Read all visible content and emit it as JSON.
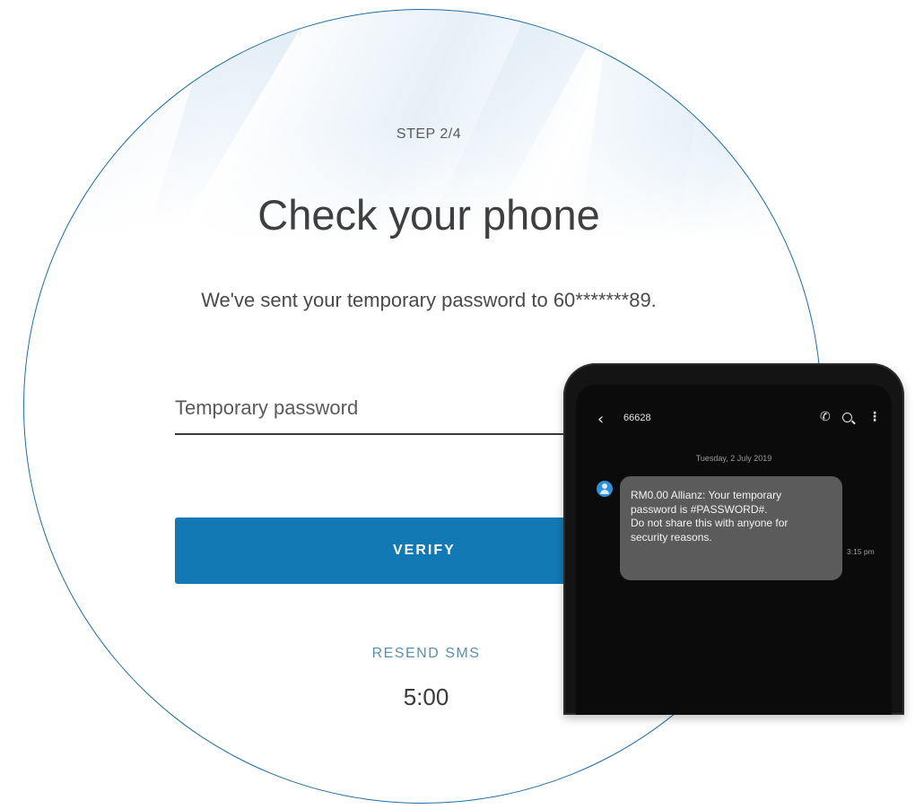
{
  "step_label": "STEP 2/4",
  "title": "Check your phone",
  "subtitle": "We've sent your temporary password to 60*******89.",
  "password_field": {
    "placeholder": "Temporary password",
    "value": ""
  },
  "verify_button": "VERIFY",
  "resend_label": "RESEND SMS",
  "timer": "5:00",
  "phone": {
    "sender": "66628",
    "date": "Tuesday, 2 July 2019",
    "message_lines": [
      "RM0.00 Allianz: Your temporary",
      "password is #PASSWORD#.",
      "Do not share this with anyone for",
      "security reasons."
    ],
    "time": "3:15 pm",
    "icons": {
      "back": "chevron-left-icon",
      "call": "phone-icon",
      "search": "search-icon",
      "menu": "more-vertical-icon",
      "contact": "avatar-icon"
    }
  },
  "colors": {
    "accent": "#1379b5",
    "resend": "#5a8fb3",
    "circle_border": "#1f6ea3",
    "bubble": "#5b5b5b"
  }
}
